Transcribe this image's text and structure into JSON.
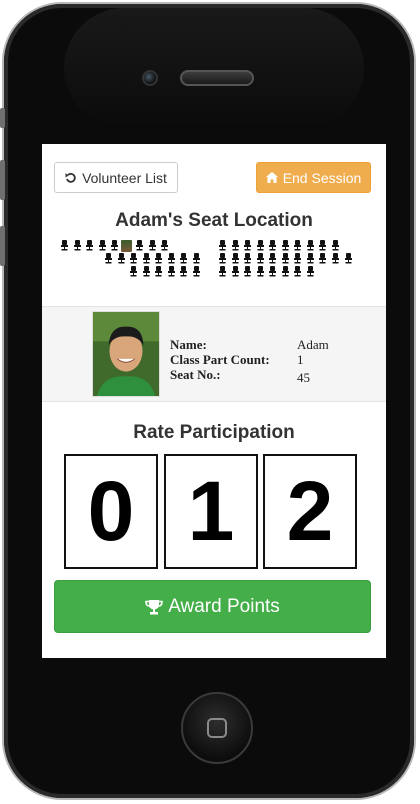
{
  "screen": {
    "volunteer_button": {
      "icon": "undo-icon",
      "label": "Volunteer List"
    },
    "end_button": {
      "icon": "home-icon",
      "label": "End Session",
      "color": "#f0ad4e"
    },
    "seat_title": "Adam's Seat Location",
    "seating": {
      "row1_left_count": 5,
      "row1_right_count": 10,
      "row2_left_count": 8,
      "row2_right_count": 10,
      "highlighted_seat": "student-photo",
      "seat_icon": "chair-icon"
    },
    "profile": {
      "name_label": "Name:",
      "name_value": "Adam",
      "count_label": "Class Part Count:",
      "count_value": "1",
      "seat_label": "Seat No.:",
      "seat_value": "45"
    },
    "rate_title": "Rate Participation",
    "counter_digits": [
      "0",
      "1",
      "2"
    ],
    "award_button": {
      "icon": "trophy-icon",
      "label": "Award Points",
      "color": "#44ae49"
    }
  }
}
